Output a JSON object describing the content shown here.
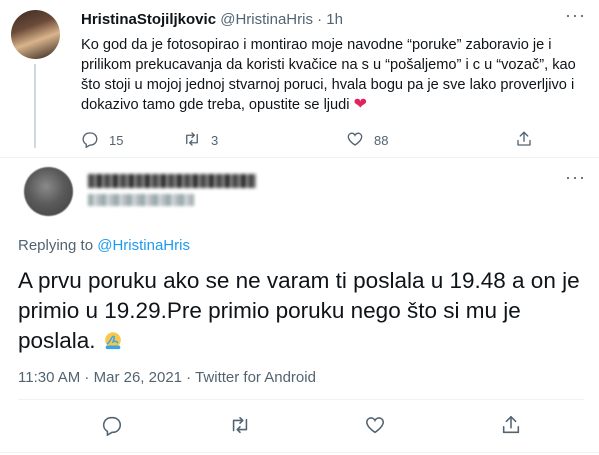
{
  "tweet1": {
    "display_name": "HristinaStojiljkovic",
    "handle": "@HristinaHris",
    "separator": "·",
    "time_ago": "1h",
    "text": "Ko god da je fotosopirao i montirao moje navodne “poruke” zaboravio je i prilikom prekucavanja da koristi kvačice na s u “pošaljemo” i c u “vozač”, kao što stoji u mojoj jednoj stvarnoj poruci, hvala bogu pa je sve lako proverljivo i dokazivo tamo gde treba, opustite se ljudi",
    "emoji": "❤",
    "reply_count": "15",
    "retweet_count": "3",
    "like_count": "88",
    "more": "···"
  },
  "tweet2": {
    "more": "···",
    "replying_prefix": "Replying to ",
    "replying_to": "@HristinaHris",
    "text": "A prvu poruku ako se ne varam ti poslala u 19.48 a on je primio u 19.29.Pre primio poruku nego što si mu je poslala.",
    "time": "11:30 AM",
    "dot": " · ",
    "date": "Mar 26, 2021",
    "source": "Twitter for Android"
  },
  "colors": {
    "accent": "#1d9bf0",
    "secondary_text": "#536471",
    "heart": "#e0245e"
  },
  "icons": [
    "more-icon",
    "reply-icon",
    "retweet-icon",
    "like-icon",
    "share-icon",
    "facepalm-emoji"
  ]
}
